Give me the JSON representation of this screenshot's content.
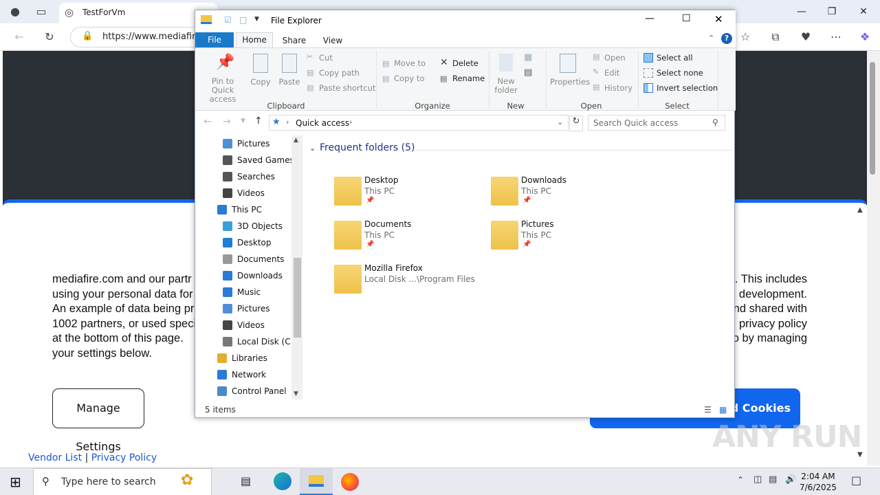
{
  "browser": {
    "tab_title": "TestForVm",
    "url": "https://www.mediafire"
  },
  "consent": {
    "text": "mediafire.com and our partr                                                                                    e. This includes using your personal data for                                                                                       development. An example of data being pr                                                                                  nd shared with 1002 partners, or used speci                                                                                    privacy policy at the bottom of this page.                                                                                   o by managing your settings below.",
    "lines": [
      [
        "mediafire.com and our partr",
        "e. This includes"
      ],
      [
        "using your personal data for",
        "development."
      ],
      [
        "An example of data being pr",
        "nd shared with"
      ],
      [
        "1002 partners, or used speci",
        "privacy policy"
      ],
      [
        "at the bottom of this page.",
        "o by managing"
      ],
      [
        "your settings below.",
        ""
      ]
    ],
    "manage_label": "Manage Settings",
    "accept_label": "ed Cookies",
    "vendor_list": "Vendor List",
    "separator": "|",
    "privacy_policy": "Privacy Policy",
    "accent_color": "#1166ee"
  },
  "watermark": "ANY RUN",
  "explorer": {
    "title": "File Explorer",
    "tabs": {
      "file": "File",
      "home": "Home",
      "share": "Share",
      "view": "View"
    },
    "ribbon": {
      "pin": "Pin to Quick access",
      "copy": "Copy",
      "paste": "Paste",
      "cut": "Cut",
      "copy_path": "Copy path",
      "paste_shortcut": "Paste shortcut",
      "clipboard_group": "Clipboard",
      "move_to": "Move to",
      "copy_to": "Copy to",
      "delete": "Delete",
      "rename": "Rename",
      "organize_group": "Organize",
      "new_folder": "New folder",
      "new_group": "New",
      "properties": "Properties",
      "open": "Open",
      "edit": "Edit",
      "history": "History",
      "open_group": "Open",
      "select_all": "Select all",
      "select_none": "Select none",
      "invert_selection": "Invert selection",
      "select_group": "Select"
    },
    "path": "Quick access",
    "search_placeholder": "Search Quick access",
    "nav_items": [
      {
        "label": "Pictures",
        "icon": "pictures-icon",
        "indent": 1
      },
      {
        "label": "Saved Games",
        "icon": "saved-games-icon",
        "indent": 1
      },
      {
        "label": "Searches",
        "icon": "searches-icon",
        "indent": 1
      },
      {
        "label": "Videos",
        "icon": "videos-icon",
        "indent": 1
      },
      {
        "label": "This PC",
        "icon": "this-pc-icon",
        "indent": 0
      },
      {
        "label": "3D Objects",
        "icon": "3d-objects-icon",
        "indent": 1
      },
      {
        "label": "Desktop",
        "icon": "desktop-icon",
        "indent": 1
      },
      {
        "label": "Documents",
        "icon": "documents-icon",
        "indent": 1
      },
      {
        "label": "Downloads",
        "icon": "downloads-icon",
        "indent": 1
      },
      {
        "label": "Music",
        "icon": "music-icon",
        "indent": 1
      },
      {
        "label": "Pictures",
        "icon": "pictures-icon",
        "indent": 1
      },
      {
        "label": "Videos",
        "icon": "videos-icon",
        "indent": 1
      },
      {
        "label": "Local Disk (C:)",
        "icon": "local-disk-icon",
        "indent": 1
      },
      {
        "label": "Libraries",
        "icon": "libraries-icon",
        "indent": 0
      },
      {
        "label": "Network",
        "icon": "network-icon",
        "indent": 0
      },
      {
        "label": "Control Panel",
        "icon": "control-panel-icon",
        "indent": 0
      }
    ],
    "frequent_header": "Frequent folders (5)",
    "folders": [
      {
        "name": "Desktop",
        "location": "This PC",
        "pinned": true,
        "icon": "desktop-folder-icon"
      },
      {
        "name": "Downloads",
        "location": "This PC",
        "pinned": true,
        "icon": "downloads-folder-icon"
      },
      {
        "name": "Documents",
        "location": "This PC",
        "pinned": true,
        "icon": "documents-folder-icon"
      },
      {
        "name": "Pictures",
        "location": "This PC",
        "pinned": true,
        "icon": "pictures-folder-icon"
      },
      {
        "name": "Mozilla Firefox",
        "location": "Local Disk ...\\Program Files",
        "pinned": false,
        "icon": "folder-icon"
      }
    ],
    "status": "5 items"
  },
  "taskbar": {
    "search_placeholder": "Type here to search",
    "time": "2:04 AM",
    "date": "7/6/2025"
  }
}
